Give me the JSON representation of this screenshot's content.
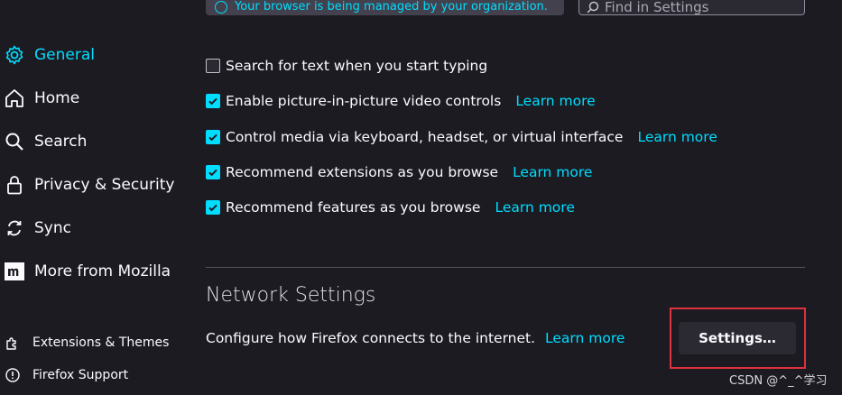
{
  "banner": {
    "text": "Your browser is being managed by your organization."
  },
  "search": {
    "placeholder": "Find in Settings"
  },
  "sidebar": {
    "items": [
      {
        "label": "General",
        "icon": "gear-icon",
        "active": true
      },
      {
        "label": "Home",
        "icon": "home-icon"
      },
      {
        "label": "Search",
        "icon": "search-icon"
      },
      {
        "label": "Privacy & Security",
        "icon": "lock-icon"
      },
      {
        "label": "Sync",
        "icon": "sync-icon"
      },
      {
        "label": "More from Mozilla",
        "icon": "mozilla-icon"
      }
    ],
    "footer": [
      {
        "label": "Extensions & Themes",
        "icon": "puzzle-icon"
      },
      {
        "label": "Firefox Support",
        "icon": "help-icon"
      }
    ]
  },
  "options": [
    {
      "label": "Search for text when you start typing",
      "checked": false,
      "learn_more": ""
    },
    {
      "label": "Enable picture-in-picture video controls",
      "checked": true,
      "learn_more": "Learn more"
    },
    {
      "label": "Control media via keyboard, headset, or virtual interface",
      "checked": true,
      "learn_more": "Learn more"
    },
    {
      "label": "Recommend extensions as you browse",
      "checked": true,
      "learn_more": "Learn more"
    },
    {
      "label": "Recommend features as you browse",
      "checked": true,
      "learn_more": "Learn more"
    }
  ],
  "network": {
    "title": "Network Settings",
    "description": "Configure how Firefox connects to the internet.",
    "learn_more": "Learn more",
    "button_label": "Settings…"
  },
  "watermark": "CSDN @^_^学习",
  "colors": {
    "accent": "#00ddff",
    "background": "#1c1b22",
    "highlight": "#e0313d"
  }
}
